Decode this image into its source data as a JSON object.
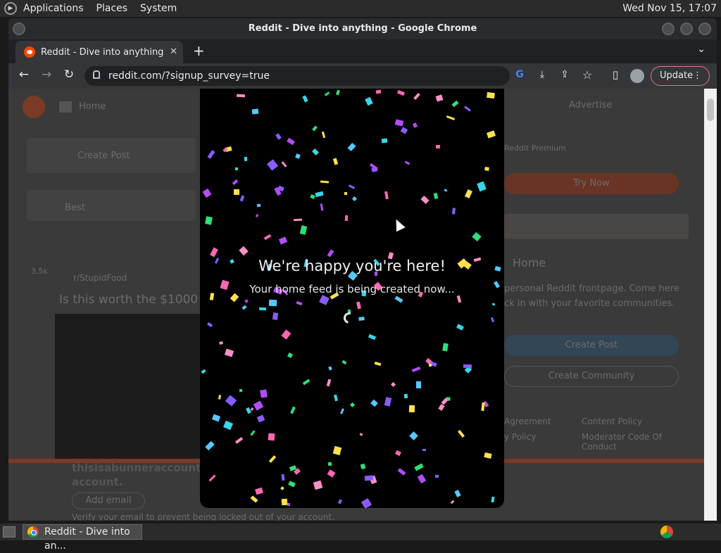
{
  "top_panel": {
    "menus": [
      "Applications",
      "Places",
      "System"
    ],
    "clock": "Wed Nov 15, 17:07"
  },
  "window": {
    "title": "Reddit - Dive into anything - Google Chrome"
  },
  "tab": {
    "title": "Reddit - Dive into anything"
  },
  "omnibox": {
    "url": "reddit.com/?signup_survey=true"
  },
  "toolbar": {
    "update_label": "Update"
  },
  "background_page": {
    "home": "Home",
    "create_post": "Create Post",
    "best": "Best",
    "subreddit": "r/StupidFood",
    "votes": "3.5k",
    "post_title": "Is this worth the $1000",
    "advertise": "Advertise",
    "premium": "Reddit Premium",
    "try_now": "Try Now",
    "home_heading": "Home",
    "home_desc": "personal Reddit frontpage. Come here ck in with your favorite communities.",
    "create_post_btn": "Create Post",
    "create_community_btn": "Create Community",
    "content_policy": "Content Policy",
    "moderator_code": "Moderator Code Of Conduct",
    "user_agreement": "Agreement",
    "privacy_policy": "y Policy",
    "account_name": "thisisabunneraccount",
    "account_suffix": "account.",
    "add_email": "Add email",
    "verify_text": "Verify your email to prevent being locked out of your account."
  },
  "modal": {
    "title": "We're happy you're here!",
    "subtitle": "Your home feed is being created now..."
  },
  "taskbar": {
    "task_label": "Reddit - Dive into an..."
  },
  "colors": {
    "confetti": [
      "#b44dff",
      "#ff66b3",
      "#3ad6e6",
      "#ffe14d",
      "#2de07a",
      "#8a5cff",
      "#ff8fc7",
      "#57c8ff"
    ]
  }
}
